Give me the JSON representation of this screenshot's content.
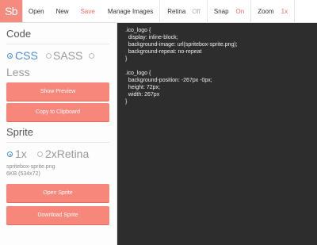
{
  "toolbar": {
    "logo": "Sb",
    "open": "Open",
    "new": "New",
    "save": "Save",
    "manage_images": "Manage Images",
    "retina": "Retina",
    "retina_value": "Off",
    "snap": "Snap",
    "snap_value": "On",
    "zoom": "Zoom",
    "zoom_value": "1x"
  },
  "colors": {
    "accent": "#f26c62",
    "button": "#f7877a",
    "code_bg": "#2d2d2d"
  },
  "sidebar": {
    "code_title": "Code",
    "code_options": [
      {
        "label": "CSS",
        "selected": true
      },
      {
        "label": "SASS",
        "selected": false
      },
      {
        "label": "Less",
        "selected": false
      }
    ],
    "show_preview": "Show Preview",
    "copy_clipboard": "Copy to Clipboard",
    "sprite_title": "Sprite",
    "sprite_options": [
      {
        "label": "1x",
        "selected": true
      },
      {
        "label": "2xRetina",
        "selected": false
      }
    ],
    "file_name": "spritebox-sprite.png",
    "file_info": "6KB (534x72)",
    "open_sprite": "Open Sprite",
    "download_sprite": "Download Sprite"
  },
  "code_lines": [
    ".ico_logo {",
    "  display: inline-block;",
    "  background-image: url(spritebox-sprite.png);",
    "  background-repeat: no-repeat",
    "}",
    "",
    ".ico_logo {",
    "  background-position: -267px -0px;",
    "  height: 72px;",
    "  width: 267px",
    "}"
  ]
}
